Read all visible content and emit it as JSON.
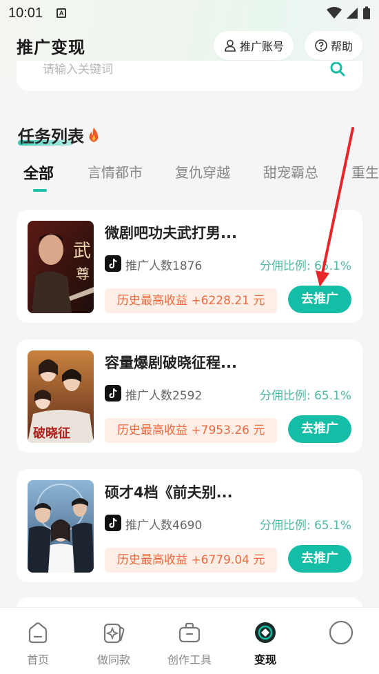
{
  "status_bar": {
    "time": "10:01",
    "notif_badge": "A"
  },
  "header": {
    "title": "推广变现",
    "account_button": "推广账号",
    "help_button": "帮助"
  },
  "search": {
    "placeholder": "请输入关键词"
  },
  "section": {
    "title": "任务列表"
  },
  "tabs": [
    "全部",
    "言情都市",
    "复仇穿越",
    "甜宠霸总",
    "重生"
  ],
  "active_tab": "全部",
  "cards": [
    {
      "title": "微剧吧功夫武打男...",
      "count": "推广人数1876",
      "ratio": "分佣比例: 65.1%",
      "earnings": "历史最高收益 +6228.21 元",
      "button": "去推广"
    },
    {
      "title": "容量爆剧破晓征程...",
      "count": "推广人数2592",
      "ratio": "分佣比例: 65.1%",
      "earnings": "历史最高收益 +7953.26 元",
      "button": "去推广"
    },
    {
      "title": "硕才4档《前夫别...",
      "count": "推广人数4690",
      "ratio": "分佣比例: 65.1%",
      "earnings": "历史最高收益 +6779.04 元",
      "button": "去推广"
    }
  ],
  "bottom_nav": [
    {
      "label": "首页",
      "icon": "home-icon"
    },
    {
      "label": "做同款",
      "icon": "sparkle-card-icon"
    },
    {
      "label": "创作工具",
      "icon": "toolbox-icon"
    },
    {
      "label": "变现",
      "icon": "monetize-icon",
      "active": true
    },
    {
      "label": "",
      "icon": "profile-circle-icon"
    }
  ],
  "colors": {
    "accent": "#14bda6",
    "earn_text": "#ef6a3c",
    "earn_bg": "#fdeee8",
    "arrow": "#e8262a"
  }
}
